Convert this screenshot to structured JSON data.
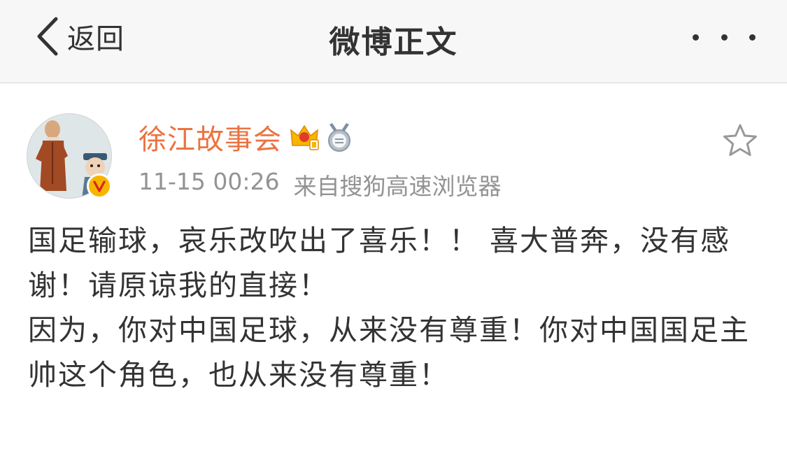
{
  "nav": {
    "back_label": "返回",
    "title": "微博正文"
  },
  "post": {
    "username": "徐江故事会",
    "time": "11-15 00:26",
    "source": "来自搜狗高速浏览器",
    "paragraphs": [
      "国足输球，哀乐改吹出了喜乐！！ 喜大普奔，没有感谢！请原谅我的直接！",
      "因为，你对中国足球，从来没有尊重！你对中国国足主帅这个角色，也从来没有尊重！"
    ]
  },
  "icons": {
    "back": "chevron-left-icon",
    "more": "more-dots-icon",
    "verified": "verified-v-badge-icon",
    "crown": "vip-crown-icon",
    "medal": "answer-medal-icon",
    "favorite": "star-outline-icon"
  },
  "colors": {
    "username": "#eb7340",
    "meta": "#939393",
    "text": "#333333",
    "navbar_bg": "#f7f7f7",
    "badge": "#f7b500"
  }
}
